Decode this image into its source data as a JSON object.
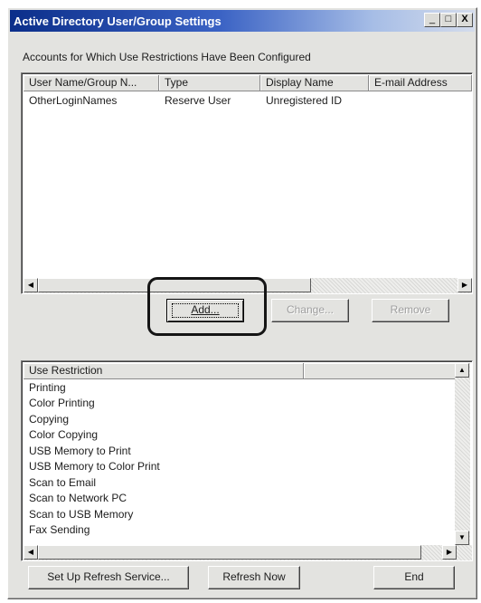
{
  "window": {
    "title": "Active Directory User/Group Settings",
    "minimize_glyph": "_",
    "maximize_glyph": "□",
    "close_glyph": "X"
  },
  "accounts": {
    "section_label": "Accounts for Which Use Restrictions Have Been Configured",
    "columns": [
      "User Name/Group N...",
      "Type",
      "Display Name",
      "E-mail Address"
    ],
    "rows": [
      [
        "OtherLoginNames",
        "Reserve User",
        "Unregistered ID",
        ""
      ]
    ]
  },
  "actions": {
    "add_label": "Add...",
    "change_label": "Change...",
    "remove_label": "Remove"
  },
  "restrictions": {
    "columns": [
      "Use Restriction",
      ""
    ],
    "items": [
      "Printing",
      "Color Printing",
      "Copying",
      "Color Copying",
      "USB Memory to Print",
      "USB Memory to Color Print",
      "Scan to Email",
      "Scan to Network PC",
      "Scan to USB Memory",
      "Fax Sending"
    ]
  },
  "footer": {
    "refresh_service_label": "Set Up Refresh Service...",
    "refresh_now_label": "Refresh Now",
    "end_label": "End"
  },
  "icons": {
    "scroll_left": "◀",
    "scroll_right": "▶",
    "scroll_up": "▲",
    "scroll_down": "▼"
  }
}
